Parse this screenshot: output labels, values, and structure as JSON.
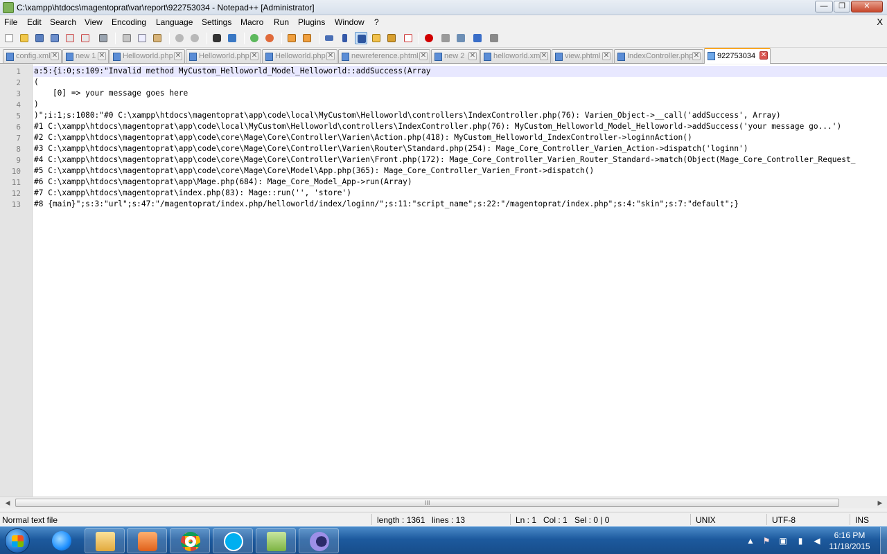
{
  "window": {
    "title": "C:\\xampp\\htdocs\\magentoprat\\var\\report\\922753034 - Notepad++ [Administrator]",
    "min_glyph": "—",
    "max_glyph": "❐",
    "close_glyph": "✕"
  },
  "menu": {
    "items": [
      "File",
      "Edit",
      "Search",
      "View",
      "Encoding",
      "Language",
      "Settings",
      "Macro",
      "Run",
      "Plugins",
      "Window",
      "?"
    ],
    "close_glyph": "X"
  },
  "toolbar": {
    "icons": [
      "new-file-icon",
      "open-file-icon",
      "save-icon",
      "save-all-icon",
      "close-file-icon",
      "close-all-icon",
      "print-icon",
      "cut-icon",
      "copy-icon",
      "paste-icon",
      "undo-icon",
      "redo-icon",
      "find-icon",
      "replace-icon",
      "zoom-in-icon",
      "zoom-out-icon",
      "sync-vertical-icon",
      "sync-horizontal-icon",
      "word-wrap-icon",
      "show-all-chars-icon",
      "indent-guide-icon",
      "user-define-icon",
      "doc-map-icon",
      "function-list-icon",
      "record-macro-icon",
      "stop-macro-icon",
      "play-macro-icon",
      "run-macro-multiple-icon",
      "save-macro-icon"
    ]
  },
  "tabs": [
    {
      "label": "config.xml",
      "active": false
    },
    {
      "label": "new 1",
      "active": false
    },
    {
      "label": "Helloworld.php",
      "active": false
    },
    {
      "label": "Helloworld.php",
      "active": false
    },
    {
      "label": "Helloworld.php",
      "active": false
    },
    {
      "label": "newreference.phtml",
      "active": false
    },
    {
      "label": "new 2",
      "active": false
    },
    {
      "label": "helloworld.xml",
      "active": false
    },
    {
      "label": "view.phtml",
      "active": false
    },
    {
      "label": "IndexController.php",
      "active": false
    },
    {
      "label": "922753034",
      "active": true
    }
  ],
  "tab_close_glyph": "✕",
  "editor": {
    "lines": [
      "a:5:{i:0;s:109:\"Invalid method MyCustom_Helloworld_Model_Helloworld::addSuccess(Array",
      "(",
      "    [0] => your message goes here",
      ")",
      ")\";i:1;s:1080:\"#0 C:\\xampp\\htdocs\\magentoprat\\app\\code\\local\\MyCustom\\Helloworld\\controllers\\IndexController.php(76): Varien_Object->__call('addSuccess', Array)",
      "#1 C:\\xampp\\htdocs\\magentoprat\\app\\code\\local\\MyCustom\\Helloworld\\controllers\\IndexController.php(76): MyCustom_Helloworld_Model_Helloworld->addSuccess('your message go...')",
      "#2 C:\\xampp\\htdocs\\magentoprat\\app\\code\\core\\Mage\\Core\\Controller\\Varien\\Action.php(418): MyCustom_Helloworld_IndexController->loginnAction()",
      "#3 C:\\xampp\\htdocs\\magentoprat\\app\\code\\core\\Mage\\Core\\Controller\\Varien\\Router\\Standard.php(254): Mage_Core_Controller_Varien_Action->dispatch('loginn')",
      "#4 C:\\xampp\\htdocs\\magentoprat\\app\\code\\core\\Mage\\Core\\Controller\\Varien\\Front.php(172): Mage_Core_Controller_Varien_Router_Standard->match(Object(Mage_Core_Controller_Request_",
      "#5 C:\\xampp\\htdocs\\magentoprat\\app\\code\\core\\Mage\\Core\\Model\\App.php(365): Mage_Core_Controller_Varien_Front->dispatch()",
      "#6 C:\\xampp\\htdocs\\magentoprat\\app\\Mage.php(684): Mage_Core_Model_App->run(Array)",
      "#7 C:\\xampp\\htdocs\\magentoprat\\index.php(83): Mage::run('', 'store')",
      "#8 {main}\";s:3:\"url\";s:47:\"/magentoprat/index.php/helloworld/index/loginn/\";s:11:\"script_name\";s:22:\"/magentoprat/index.php\";s:4:\"skin\";s:7:\"default\";}"
    ]
  },
  "hscroll": {
    "left_arrow": "◀",
    "right_arrow": "▶",
    "grip": "III"
  },
  "status": {
    "file_type": "Normal text file",
    "length": "length : 1361",
    "lines": "lines : 13",
    "ln": "Ln : 1",
    "col": "Col : 1",
    "sel": "Sel : 0 | 0",
    "eol": "UNIX",
    "encoding": "UTF-8",
    "mode": "INS"
  },
  "taskbar": {
    "apps": [
      {
        "name": "internet-explorer-icon",
        "color": "#1e90ff"
      },
      {
        "name": "file-explorer-icon",
        "color": "#f0c45a"
      },
      {
        "name": "media-player-icon",
        "color": "#f08030"
      },
      {
        "name": "chrome-icon",
        "color": "#db4437"
      },
      {
        "name": "skype-icon",
        "color": "#00aff0"
      },
      {
        "name": "notepad-plus-plus-icon",
        "color": "#8bc34a"
      },
      {
        "name": "eclipse-icon",
        "color": "#7b68ee"
      }
    ],
    "time": "6:16 PM",
    "date": "11/18/2015"
  }
}
